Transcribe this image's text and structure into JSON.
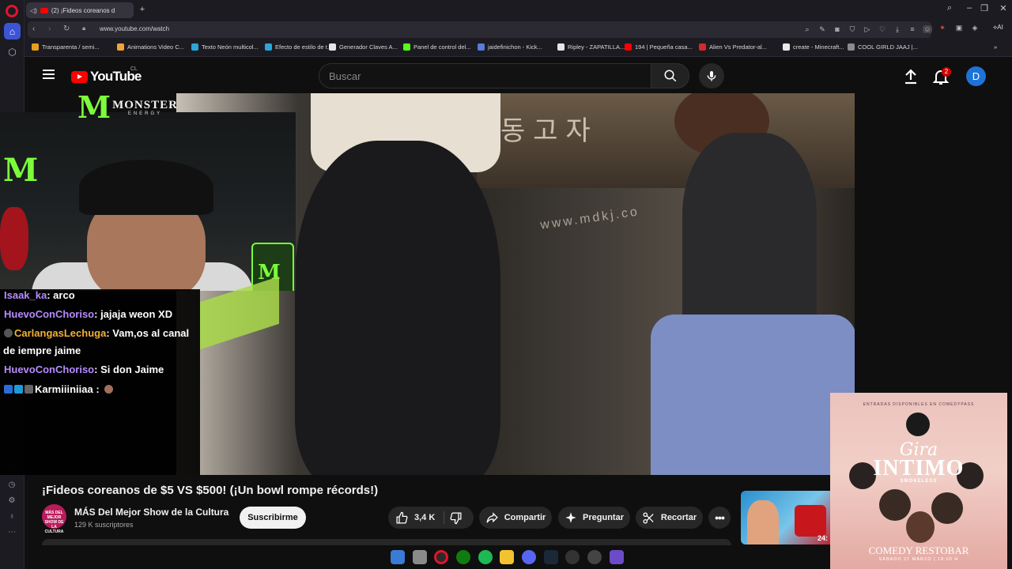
{
  "browser": {
    "tab_title": "(2) ¡Fideos coreanos d",
    "url": "www.youtube.com/watch",
    "ai_label": "AI",
    "bookmarks": [
      {
        "label": "Transparenta / semi...",
        "color": "#e6a11a"
      },
      {
        "label": "Animations Video C...",
        "color": "#f2a23c"
      },
      {
        "label": "Texto Neón multicol...",
        "color": "#2aa6d8"
      },
      {
        "label": "Efecto de estilo de t...",
        "color": "#2aa6d8"
      },
      {
        "label": "Generador Claves A...",
        "color": "#e6e6e6"
      },
      {
        "label": "Panel de control del...",
        "color": "#53fc18"
      },
      {
        "label": "jaidefinichon - Kick...",
        "color": "#5a7bd8"
      },
      {
        "label": "Ripley - ZAPATILLA...",
        "color": "#e6e6e6"
      },
      {
        "label": "194 | Pequeña casa...",
        "color": "#ff0000"
      },
      {
        "label": "Alien Vs Predator-al...",
        "color": "#d22a2a"
      },
      {
        "label": "create - Minecraft...",
        "color": "#e9e9e9"
      },
      {
        "label": "COOL GIRLD JAAJ |...",
        "color": "#8b8b8b"
      }
    ]
  },
  "youtube": {
    "logo_text": "YouTube",
    "country_code": "CL",
    "search_placeholder": "Buscar",
    "notification_count": "2",
    "avatar_letter": "D"
  },
  "overlay": {
    "monster_text": "MONSTER",
    "monster_sub": "ENERGY",
    "chat": [
      {
        "user": "Isaak_ka",
        "text": ": arco",
        "style": "purple"
      },
      {
        "user": "HuevoConChoriso",
        "text": ": jajaja weon XD",
        "style": "purple"
      },
      {
        "user": "CarlangasLechuga",
        "text": ": Vam,os al canal",
        "style": "gold"
      },
      {
        "user": "",
        "text": "de iempre jaime",
        "style": "plain"
      },
      {
        "user": "HuevoConChoriso",
        "text": ": Si don Jaime",
        "style": "purple"
      },
      {
        "user": "Karmiiiniiaa",
        "text": " :",
        "style": "white"
      }
    ]
  },
  "video": {
    "title": "¡Fideos coreanos de $5 VS $500! (¡Un bowl rompe récords!)",
    "sign_text": "동고자",
    "www_text": "www.mdkj.co",
    "channel_name": "MÁS Del Mejor Show de la Cultura",
    "channel_subs": "129 K suscriptores",
    "channel_avatar_text": "MÁS DEL MEJOR SHOW DE LA CULTURA",
    "subscribe_label": "Suscribirme",
    "like_count": "3,4 K",
    "share_label": "Compartir",
    "ask_label": "Preguntar",
    "clip_label": "Recortar",
    "rec_duration": "24:"
  },
  "poster": {
    "top_text": "ENTRADAS DISPONIBLES EN COMEDYPASS",
    "gira": "Gira",
    "intimo": "INTIMO",
    "smokeless": "SMOKELESS",
    "venue": "COMEDY RESTOBAR",
    "date": "SÁBADO 21 MARZO | 18:00 H"
  }
}
